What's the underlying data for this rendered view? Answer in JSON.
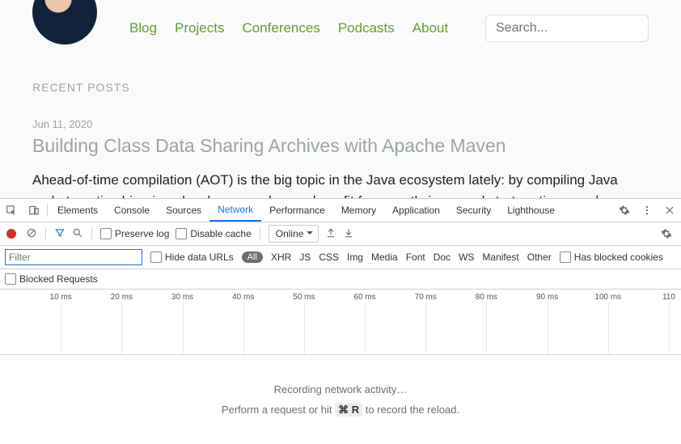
{
  "nav": {
    "items": [
      "Blog",
      "Projects",
      "Conferences",
      "Podcasts",
      "About"
    ]
  },
  "search": {
    "placeholder": "Search..."
  },
  "recent_label": "RECENT POSTS",
  "post": {
    "date": "Jun 11, 2020",
    "title": "Building Class Data Sharing Archives with Apache Maven",
    "body": "Ahead-of-time compilation (AOT) is the big topic in the Java ecosystem lately: by compiling Java code to native binaries, developers and users benefit from vastly improved start-up times and reduced memory"
  },
  "devtools": {
    "tabs": [
      "Elements",
      "Console",
      "Sources",
      "Network",
      "Performance",
      "Memory",
      "Application",
      "Security",
      "Lighthouse"
    ],
    "active_tab": "Network",
    "toolbar": {
      "preserve_log": "Preserve log",
      "disable_cache": "Disable cache",
      "throttle": "Online"
    },
    "filter": {
      "placeholder": "Filter",
      "hide_data_urls": "Hide data URLs",
      "types": [
        "All",
        "XHR",
        "JS",
        "CSS",
        "Img",
        "Media",
        "Font",
        "Doc",
        "WS",
        "Manifest",
        "Other"
      ],
      "has_blocked_cookies": "Has blocked cookies",
      "blocked_requests": "Blocked Requests"
    },
    "timeline_ticks": [
      "10 ms",
      "20 ms",
      "30 ms",
      "40 ms",
      "50 ms",
      "60 ms",
      "70 ms",
      "80 ms",
      "90 ms",
      "100 ms",
      "110"
    ],
    "recording": {
      "line1": "Recording network activity…",
      "line2_pre": "Perform a request or hit ",
      "line2_key": "⌘ R",
      "line2_post": " to record the reload."
    }
  }
}
